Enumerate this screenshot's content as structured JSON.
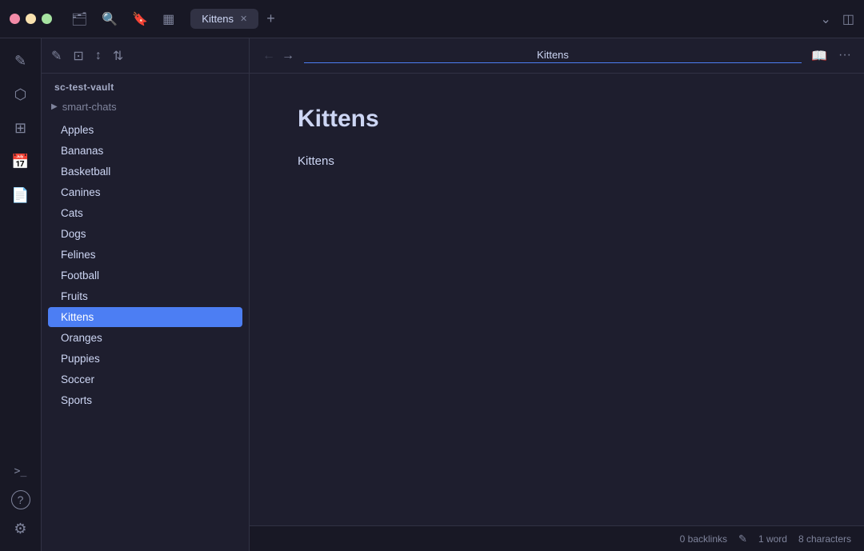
{
  "titlebar": {
    "tab_label": "Kittens",
    "close_label": "✕",
    "add_tab_label": "+"
  },
  "sidebar": {
    "vault_name": "sc-test-vault",
    "smart_chats_label": "smart-chats",
    "toolbar": {
      "new_note": "✎",
      "open_folder": "⊡",
      "sort": "↕",
      "switch": "⇅"
    },
    "items": [
      {
        "id": "apples",
        "label": "Apples",
        "active": false
      },
      {
        "id": "bananas",
        "label": "Bananas",
        "active": false
      },
      {
        "id": "basketball",
        "label": "Basketball",
        "active": false
      },
      {
        "id": "canines",
        "label": "Canines",
        "active": false
      },
      {
        "id": "cats",
        "label": "Cats",
        "active": false
      },
      {
        "id": "dogs",
        "label": "Dogs",
        "active": false
      },
      {
        "id": "felines",
        "label": "Felines",
        "active": false
      },
      {
        "id": "football",
        "label": "Football",
        "active": false
      },
      {
        "id": "fruits",
        "label": "Fruits",
        "active": false
      },
      {
        "id": "kittens",
        "label": "Kittens",
        "active": true
      },
      {
        "id": "oranges",
        "label": "Oranges",
        "active": false
      },
      {
        "id": "puppies",
        "label": "Puppies",
        "active": false
      },
      {
        "id": "soccer",
        "label": "Soccer",
        "active": false
      },
      {
        "id": "sports",
        "label": "Sports",
        "active": false
      }
    ]
  },
  "content": {
    "header_title": "Kittens",
    "doc_title": "Kittens",
    "doc_body": "Kittens"
  },
  "statusbar": {
    "backlinks": "0 backlinks",
    "word_count": "1 word",
    "char_count": "8 characters"
  },
  "icons": {
    "folder": "🗂",
    "search": "🔍",
    "bookmark": "🔖",
    "layout": "▦",
    "chevron_down": "⌄",
    "sidebar_toggle": "◫",
    "graph": "⬡",
    "plugins": "⊞",
    "calendar": "📅",
    "file": "📄",
    "terminal": ">_",
    "help": "?",
    "settings": "⚙",
    "reading": "📖",
    "more": "···",
    "arrow_left": "←",
    "arrow_right": "→",
    "pencil": "✎"
  }
}
